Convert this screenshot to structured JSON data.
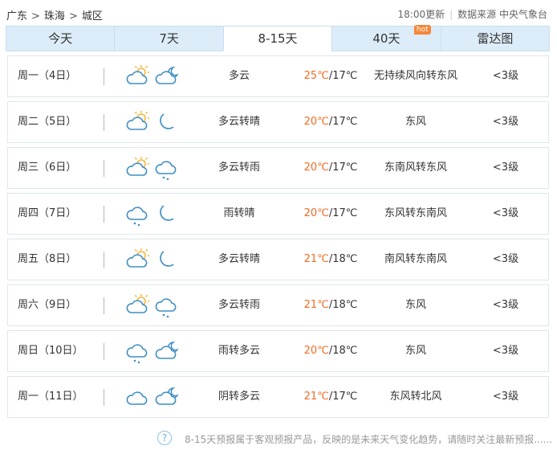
{
  "breadcrumb": [
    "广东",
    "珠海",
    "城区"
  ],
  "breadcrumb_separator": ">",
  "update": {
    "time": "18:00更新",
    "source": "数据来源 中央气象台"
  },
  "tabs": [
    {
      "label": "今天",
      "active": false
    },
    {
      "label": "7天",
      "active": false
    },
    {
      "label": "8-15天",
      "active": true
    },
    {
      "label": "40天",
      "active": false,
      "badge": "hot"
    },
    {
      "label": "雷达图",
      "active": false
    }
  ],
  "colors": {
    "high_temp": "#f36b24",
    "tab_bg": "#dcecf8",
    "icon_stroke": "#3f8fc4",
    "sun": "#f6b53b",
    "hot_badge": "#f7863a"
  },
  "forecast": [
    {
      "day": "周一（4日）",
      "icon_day": "partly-cloudy-day-icon",
      "icon_night": "partly-cloudy-night-icon",
      "desc": "多云",
      "high": "25℃",
      "low": "/17℃",
      "wind": "无持续风向转东风",
      "level": "<3级"
    },
    {
      "day": "周二（5日）",
      "icon_day": "partly-cloudy-day-icon",
      "icon_night": "moon-icon",
      "desc": "多云转晴",
      "high": "20℃",
      "low": "/17℃",
      "wind": "东风",
      "level": "<3级"
    },
    {
      "day": "周三（6日）",
      "icon_day": "partly-cloudy-day-icon",
      "icon_night": "rain-icon",
      "desc": "多云转雨",
      "high": "20℃",
      "low": "/17℃",
      "wind": "东南风转东风",
      "level": "<3级"
    },
    {
      "day": "周四（7日）",
      "icon_day": "rain-icon",
      "icon_night": "moon-icon",
      "desc": "雨转晴",
      "high": "20℃",
      "low": "/17℃",
      "wind": "东风转东南风",
      "level": "<3级"
    },
    {
      "day": "周五（8日）",
      "icon_day": "partly-cloudy-day-icon",
      "icon_night": "moon-icon",
      "desc": "多云转晴",
      "high": "21℃",
      "low": "/18℃",
      "wind": "南风转东南风",
      "level": "<3级"
    },
    {
      "day": "周六（9日）",
      "icon_day": "partly-cloudy-day-icon",
      "icon_night": "rain-icon",
      "desc": "多云转雨",
      "high": "21℃",
      "low": "/18℃",
      "wind": "东风",
      "level": "<3级"
    },
    {
      "day": "周日（10日）",
      "icon_day": "rain-icon",
      "icon_night": "partly-cloudy-night-icon",
      "desc": "雨转多云",
      "high": "20℃",
      "low": "/18℃",
      "wind": "东风",
      "level": "<3级"
    },
    {
      "day": "周一（11日）",
      "icon_day": "cloud-icon",
      "icon_night": "partly-cloudy-night-icon",
      "desc": "阴转多云",
      "high": "21℃",
      "low": "/17℃",
      "wind": "东风转北风",
      "level": "<3级"
    }
  ],
  "footnote": {
    "icon": "question-icon",
    "text": "8-15天预报属于客观预报产品，反映的是未来天气变化趋势，请随时关注最新预报......"
  }
}
